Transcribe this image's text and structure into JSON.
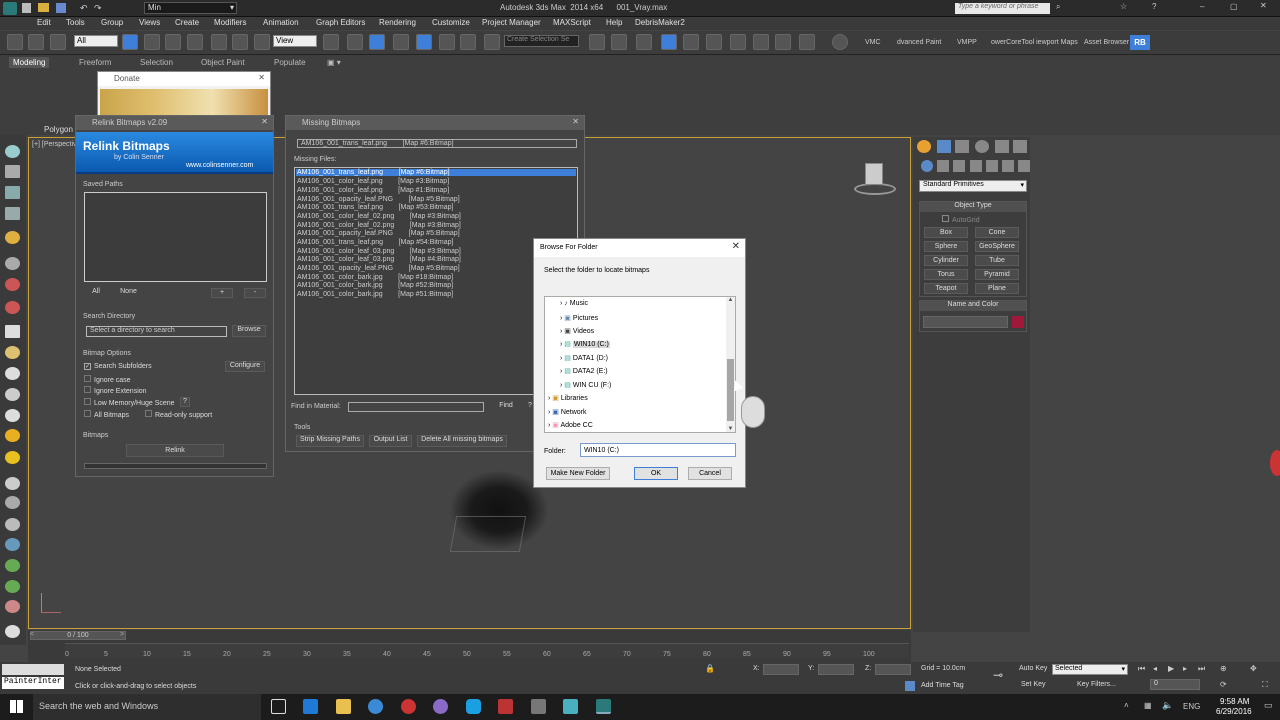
{
  "app": {
    "title": "Autodesk 3ds Max  2014 x64      001_Vray.max",
    "workspace": "Min",
    "search_placeholder": "Type a keyword or phrase"
  },
  "menu": [
    "Edit",
    "Tools",
    "Group",
    "Views",
    "Create",
    "Modifiers",
    "Animation",
    "Graph Editors",
    "Rendering",
    "Customize",
    "Project Manager",
    "MAXScript",
    "Help",
    "DebrisMaker2"
  ],
  "toolbar": {
    "filter": "All",
    "view": "View",
    "selection_set": "Create Selection Se",
    "plugins": [
      "VMC",
      "dvanced Paint",
      "VMPP",
      "owerCoreTool iewport Maps",
      "Asset Browser",
      "RB"
    ]
  },
  "ribbon": {
    "tabs": [
      "Modeling",
      "Freeform",
      "Selection",
      "Object Paint",
      "Populate"
    ],
    "polygon_label": "Polygon"
  },
  "viewport": {
    "label": "[+] [Perspective"
  },
  "donate": {
    "title": "Donate"
  },
  "relink": {
    "title": "Relink Bitmaps v2.09",
    "banner_title": "Relink Bitmaps",
    "banner_by": "by Colin Senner",
    "banner_url": "www.colinsenner.com",
    "saved_paths": "Saved Paths",
    "all": "All",
    "none": "None",
    "plus": "+",
    "minus": "-",
    "search_directory": "Search Directory",
    "directory_placeholder": "Select a directory to search",
    "browse": "Browse",
    "bitmap_options": "Bitmap Options",
    "search_subfolders": "Search Subfolders",
    "configure": "Configure",
    "ignore_case": "Ignore case",
    "ignore_extension": "Ignore Extension",
    "low_memory": "Low Memory/Huge Scene",
    "help_q": "?",
    "all_bitmaps": "All Bitmaps",
    "readonly": "Read-only support",
    "bitmaps": "Bitmaps",
    "relink": "Relink"
  },
  "missing": {
    "title": "Missing Bitmaps",
    "current": "AM106_001_trans_leaf.png        [Map #6:Bitmap]",
    "missing_files": "Missing Files:",
    "files": [
      "AM106_001_trans_leaf.png        [Map #6:Bitmap]",
      "AM106_001_color_leaf.png        [Map #3:Bitmap]",
      "AM106_001_color_leaf.png        [Map #1:Bitmap]",
      "AM106_001_opacity_leaf.PNG        [Map #5:Bitmap]",
      "AM106_001_trans_leaf.png        [Map #53:Bitmap]",
      "AM106_001_color_leaf_02.png        [Map #3:Bitmap]",
      "AM106_001_color_leaf_02.png        [Map #3:Bitmap]",
      "AM106_001_opacity_leaf.PNG        [Map #5:Bitmap]",
      "AM106_001_trans_leaf.png        [Map #54:Bitmap]",
      "AM106_001_color_leaf_03.png        [Map #3:Bitmap]",
      "AM106_001_color_leaf_03.png        [Map #4:Bitmap]",
      "AM106_001_opacity_leaf.PNG        [Map #5:Bitmap]",
      "AM106_001_color_bark.jpg        [Map #18:Bitmap]",
      "AM106_001_color_bark.jpg        [Map #52:Bitmap]",
      "AM106_001_color_bark.jpg        [Map #51:Bitmap]"
    ],
    "find_in_material": "Find in Material:",
    "find": "Find",
    "help": "?",
    "tools": "Tools",
    "strip": "Strip Missing Paths",
    "output": "Output List",
    "delete_all": "Delete All missing bitmaps"
  },
  "browse": {
    "title": "Browse For Folder",
    "prompt": "Select the folder to locate bitmaps",
    "tree": [
      "Music",
      "Pictures",
      "Videos",
      "WIN10 (C:)",
      "DATA1 (D:)",
      "DATA2 (E:)",
      "WIN CU (F:)",
      "Libraries",
      "Network",
      "Adobe CC"
    ],
    "folder_label": "Folder:",
    "folder_value": "WIN10 (C:)",
    "make_new": "Make New Folder",
    "ok": "OK",
    "cancel": "Cancel"
  },
  "command_panel": {
    "dropdown": "Standard Primitives",
    "object_type": "Object Type",
    "autogrid": "AutoGrid",
    "objects": [
      "Box",
      "Cone",
      "Sphere",
      "GeoSphere",
      "Cylinder",
      "Tube",
      "Torus",
      "Pyramid",
      "Teapot",
      "Plane"
    ],
    "name_color": "Name and Color",
    "color": "#a0183a"
  },
  "timeline": {
    "frame": "0 / 100",
    "ticks": [
      "0",
      "5",
      "10",
      "15",
      "20",
      "25",
      "30",
      "35",
      "40",
      "45",
      "50",
      "55",
      "60",
      "65",
      "70",
      "75",
      "80",
      "85",
      "90",
      "95",
      "100"
    ]
  },
  "status": {
    "maxscript": "PainterInter",
    "none_selected": "None Selected",
    "prompt": "Click or click-and-drag to select objects",
    "x": "X:",
    "y": "Y:",
    "z": "Z:",
    "grid": "Grid = 10.0cm",
    "add_time_tag": "Add Time Tag",
    "auto_key": "Auto Key",
    "set_key": "Set Key",
    "selected": "Selected",
    "key_filters": "Key Filters...",
    "frame_field": "0"
  },
  "taskbar": {
    "search": "Search the web and Windows",
    "lang": "ENG",
    "time": "9:58 AM",
    "date": "6/29/2016"
  }
}
